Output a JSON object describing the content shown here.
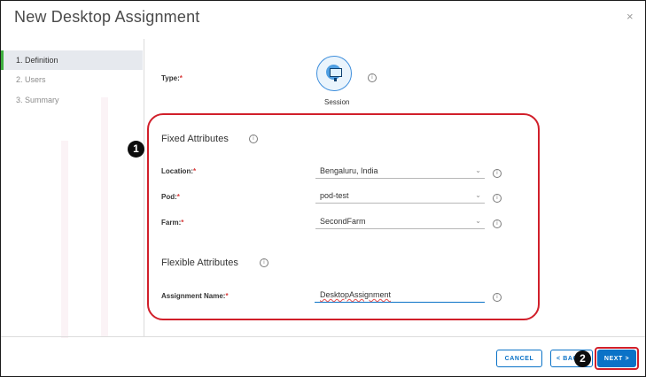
{
  "window": {
    "title": "New Desktop Assignment",
    "close_glyph": "×"
  },
  "steps": [
    {
      "label": "1. Definition"
    },
    {
      "label": "2. Users"
    },
    {
      "label": "3. Summary"
    }
  ],
  "type_field": {
    "label": "Type:",
    "required_mark": "*",
    "option_caption": "Session",
    "icon": "desktop-monitor-icon"
  },
  "fixed_attributes": {
    "heading": "Fixed Attributes",
    "location": {
      "label": "Location:",
      "required_mark": "*",
      "value": "Bengaluru, India"
    },
    "pod": {
      "label": "Pod:",
      "required_mark": "*",
      "value": "pod-test"
    },
    "farm": {
      "label": "Farm:",
      "required_mark": "*",
      "value": "SecondFarm"
    }
  },
  "flexible_attributes": {
    "heading": "Flexible Attributes",
    "assignment_name": {
      "label": "Assignment Name:",
      "required_mark": "*",
      "value": "DesktopAssignment"
    }
  },
  "callouts": {
    "first": "1",
    "second": "2"
  },
  "footer": {
    "cancel_label": "CANCEL",
    "back_label": "< BACK",
    "next_label": "NEXT >"
  },
  "colors": {
    "accent": "#0a72c7",
    "highlight": "#d11f2a",
    "active_step_bar": "#3eaf3e"
  },
  "info_glyph": "i"
}
